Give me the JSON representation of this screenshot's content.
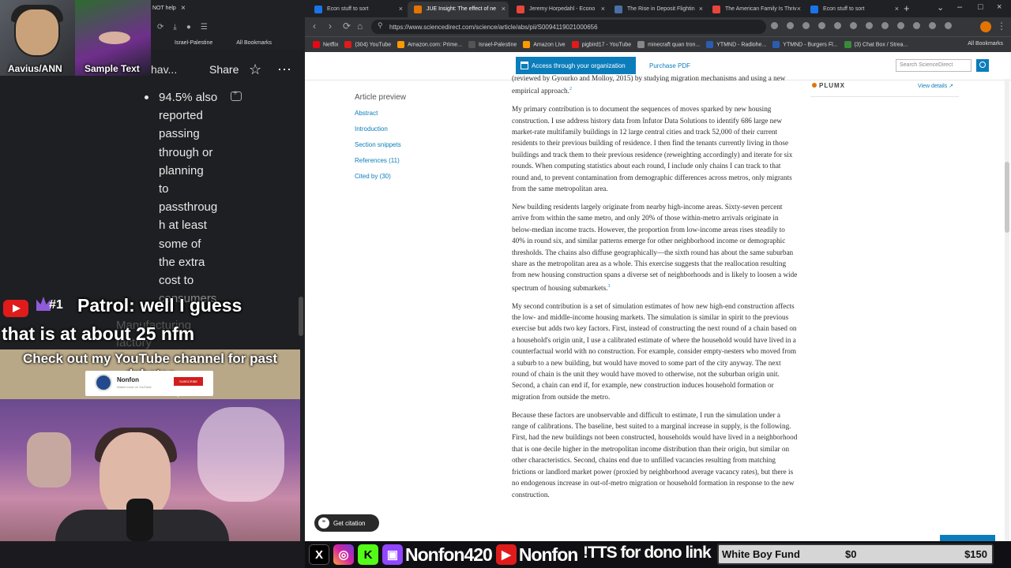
{
  "overlay": {
    "cam_a_label": "Aavius/ANN",
    "cam_b_label": "Sample Text",
    "mini_tab_label": "NOT help",
    "mini_bookmark_1": "Israel-Palestine",
    "mini_bookmark_2": "All Bookmarks",
    "doc_heading_partial": "hav...",
    "share_label": "Share",
    "bullet_lines": [
      "94.5% also",
      "reported",
      "passing",
      "through or",
      "planning",
      "to",
      "passthroug",
      "h at least",
      "some of",
      "the extra",
      "cost to"
    ],
    "bullet_fade": "consumers",
    "ghost_lines": [
      "Manufacturing",
      "factory"
    ],
    "chat_rank": "#1",
    "chat_line_1": "Patrol: well I guess",
    "chat_line_2": "that is at about 25 nfm",
    "yt_banner_title": "Check out my YouTube channel for past debates",
    "yt_card_name": "Nonfon",
    "yt_card_sub": "Watch more on YouTube",
    "yt_card_button": "SUBSCRIBE",
    "get_citation": "Get citation"
  },
  "browser": {
    "tabs": [
      {
        "label": "Econ stuff to sort",
        "color": "#1a73e8"
      },
      {
        "label": "JUE Insight: The effect of ne",
        "color": "#e37400",
        "active": true
      },
      {
        "label": "Jeremy Horpedahl - Econo",
        "color": "#e8453c"
      },
      {
        "label": "The Rise in Deposit Flightin",
        "color": "#4a6fa5"
      },
      {
        "label": "The American Family Is Thriv",
        "color": "#e8453c"
      },
      {
        "label": "Econ stuff to sort",
        "color": "#1a73e8"
      }
    ],
    "url": "https://www.sciencedirect.com/science/article/abs/pii/S0094119021000656",
    "bookmarks": [
      "Netflix",
      "(304) YouTube",
      "Amazon.com: Prime...",
      "Israel-Palestine",
      "Amazon Live",
      "pigbird17 - YouTube",
      "minecraft quan tron...",
      "YTMND - Radiohe...",
      "YTMND - Burgers Fl...",
      "(3) Chat Box / Strea..."
    ],
    "bookmarks_all": "All Bookmarks"
  },
  "sciencedirect": {
    "access_button": "Access through your organization",
    "purchase_pdf": "Purchase PDF",
    "search_placeholder": "Search ScienceDirect",
    "preview_title": "Article preview",
    "preview_links": [
      "Abstract",
      "Introduction",
      "Section snippets",
      "References (11)",
      "Cited by (30)"
    ],
    "plumx": "PLUMX",
    "view_details": "View details ↗"
  },
  "article": {
    "p0": "(reviewed by Gyourko and Molloy, 2015) by studying migration mechanisms and using a new empirical approach.",
    "p0_sup": "2",
    "p1": "My primary contribution is to document the sequences of moves sparked by new housing construction. I use address history data from Infutor Data Solutions to identify 686 large new market-rate multifamily buildings in 12 large central cities and track 52,000 of their current residents to their previous building of residence. I then find the tenants currently living in those buildings and track them to their previous residence (reweighting accordingly) and iterate for six rounds. When computing statistics about each round, I include only chains I can track to that round and, to prevent contamination from demographic differences across metros, only migrants from the same metropolitan area.",
    "p2": "New building residents largely originate from nearby high-income areas. Sixty-seven percent arrive from within the same metro, and only 20% of those within-metro arrivals originate in below-median income tracts. However, the proportion from low-income areas rises steadily to 40% in round six, and similar patterns emerge for other neighborhood income or demographic thresholds. The chains also diffuse geographically—the sixth round has about the same suburban share as the metropolitan area as a whole. This exercise suggests that the reallocation resulting from new housing construction spans a diverse set of neighborhoods and is likely to loosen a wide spectrum of housing submarkets.",
    "p2_sup": "3",
    "p3": "My second contribution is a set of simulation estimates of how new high-end construction affects the low- and middle-income housing markets. The simulation is similar in spirit to the previous exercise but adds two key factors. First, instead of constructing the next round of a chain based on a household's origin unit, I use a calibrated estimate of where the household would have lived in a counterfactual world with no construction. For example, consider empty-nesters who moved from a suburb to a new building, but would have moved to some part of the city anyway. The next round of chain is the unit they would have moved to otherwise, not the suburban origin unit. Second, a chain can end if, for example, new construction induces household formation or migration from outside the metro.",
    "p4": "Because these factors are unobservable and difficult to estimate, I run the simulation under a range of calibrations. The baseline, best suited to a marginal increase in supply, is the following. First, had the new buildings not been constructed, households would have lived in a neighborhood that is one decile higher in the metropolitan income distribution than their origin, but similar on other characteristics. Second, chains end due to unfilled vacancies resulting from matching frictions or landlord market power (proxied by neighborhood average vacancy rates), but there is no endogenous increase in out-of-metro migration or household formation in response to the new construction."
  },
  "bottom_bar": {
    "handle_1": "Nonfon420",
    "handle_2": "Nonfon",
    "tts": "!TTS for dono link",
    "fund_label": "White Boy Fund",
    "fund_current": "$0",
    "fund_goal": "$150",
    "social_icons": [
      "x-icon",
      "instagram-icon",
      "kick-icon",
      "twitch-icon",
      "youtube-icon"
    ]
  }
}
